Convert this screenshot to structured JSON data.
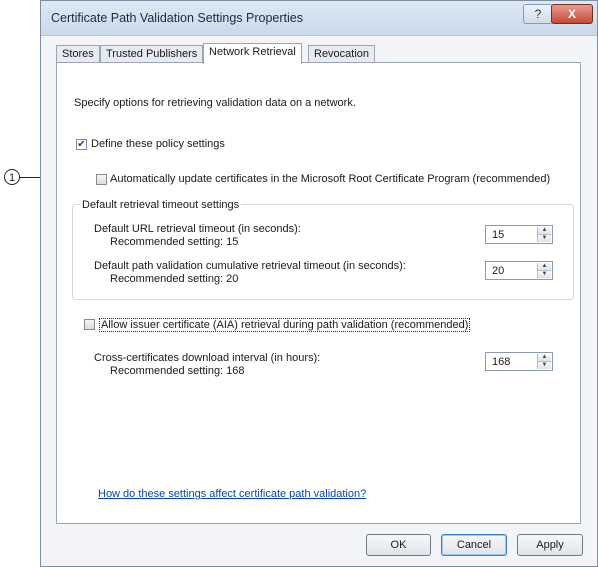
{
  "callout": {
    "number": "1"
  },
  "window": {
    "title": "Certificate Path Validation Settings Properties",
    "help_glyph": "?",
    "close_glyph": "X"
  },
  "tabs": [
    {
      "label": "Stores"
    },
    {
      "label": "Trusted Publishers"
    },
    {
      "label": "Network Retrieval"
    },
    {
      "label": "Revocation"
    }
  ],
  "panel": {
    "intro": "Specify options for retrieving validation data on a network.",
    "define_policy": {
      "label": "Define these policy settings",
      "checked": true
    },
    "auto_update": {
      "label": "Automatically update certificates in the Microsoft Root Certificate Program (recommended)",
      "checked": false
    },
    "timeout_group": {
      "label": "Default retrieval timeout settings",
      "url_timeout": {
        "label": "Default URL retrieval timeout (in seconds):",
        "recommended": "Recommended setting: 15",
        "value": "15"
      },
      "path_timeout": {
        "label": "Default path validation cumulative retrieval timeout (in seconds):",
        "recommended": "Recommended setting: 20",
        "value": "20"
      }
    },
    "aia": {
      "label": "Allow issuer certificate (AIA) retrieval during path validation (recommended)",
      "checked": false
    },
    "cross_cert": {
      "label": "Cross-certificates download interval (in hours):",
      "recommended": "Recommended setting: 168",
      "value": "168"
    },
    "help_link": "How do these settings affect certificate path validation?"
  },
  "buttons": {
    "ok": "OK",
    "cancel": "Cancel",
    "apply": "Apply"
  }
}
